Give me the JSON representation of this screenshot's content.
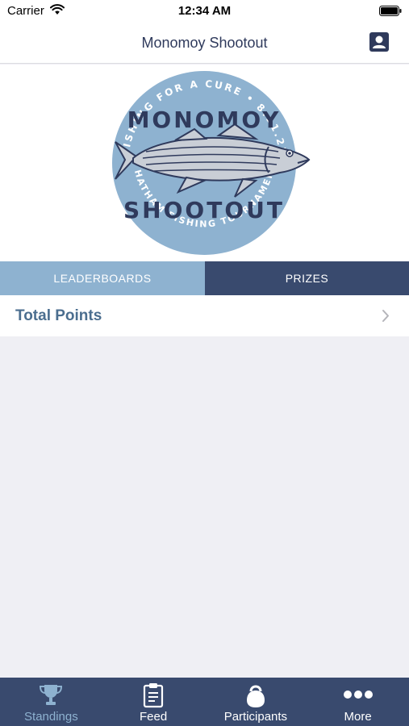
{
  "status_bar": {
    "carrier": "Carrier",
    "time": "12:34 AM",
    "icons": [
      "wifi-icon",
      "battery-icon"
    ]
  },
  "nav": {
    "title": "Monomoy Shootout",
    "right_icon": "profile-icon"
  },
  "logo": {
    "top_text": "FISHING FOR A CURE • 8.11.23",
    "name_line1": "MONOMOY",
    "name_line2": "SHOOTOUT",
    "bottom_text": "CHATHAM FISHING TOURNAMENT"
  },
  "tabs": [
    {
      "label": "LEADERBOARDS",
      "selected": true
    },
    {
      "label": "PRIZES",
      "selected": false
    }
  ],
  "list": [
    {
      "label": "Total Points",
      "icon": "chevron-right-icon"
    }
  ],
  "tab_bar": {
    "items": [
      {
        "label": "Standings",
        "icon": "trophy-icon",
        "active": true
      },
      {
        "label": "Feed",
        "icon": "clipboard-icon",
        "active": false
      },
      {
        "label": "Participants",
        "icon": "kettlebell-icon",
        "active": false
      },
      {
        "label": "More",
        "icon": "more-dots-icon",
        "active": false
      }
    ]
  },
  "colors": {
    "navy": "#394a6e",
    "light_blue": "#8eb2d0",
    "title_text": "#2f3a5c",
    "row_text": "#4b6e8f",
    "background": "#efeff4"
  }
}
